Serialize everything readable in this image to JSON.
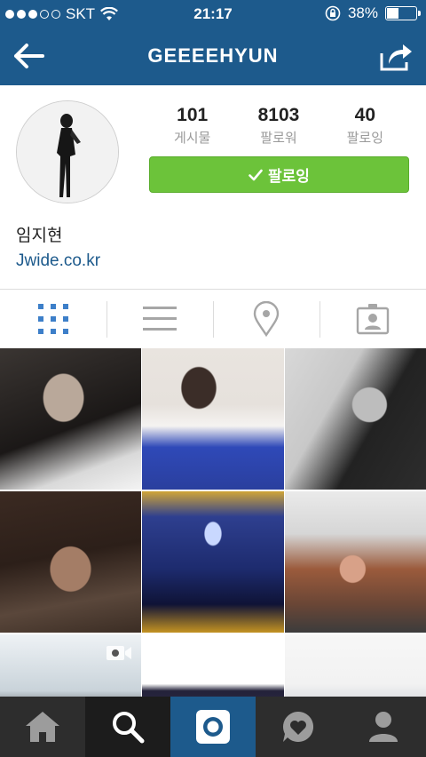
{
  "status_bar": {
    "carrier": "SKT",
    "time": "21:17",
    "battery": "38%",
    "battery_level": 0.38,
    "signal_dots": [
      true,
      true,
      true,
      false,
      false
    ]
  },
  "header": {
    "title": "GEEEEHYUN",
    "icons": {
      "back": "arrow-left-icon",
      "share": "share-icon"
    }
  },
  "profile": {
    "posts_count": "101",
    "posts_label": "게시물",
    "followers_count": "8103",
    "followers_label": "팔로워",
    "following_count": "40",
    "following_label": "팔로잉",
    "follow_button_label": "팔로잉",
    "full_name": "임지현",
    "website": "Jwide.co.kr"
  },
  "tabs": [
    {
      "name": "grid-view",
      "icon": "grid-icon",
      "active": true
    },
    {
      "name": "list-view",
      "icon": "list-icon",
      "active": false
    },
    {
      "name": "map-view",
      "icon": "location-pin-icon",
      "active": false
    },
    {
      "name": "tagged-view",
      "icon": "tagged-user-icon",
      "active": false
    }
  ],
  "grid": {
    "photos": [
      {
        "id": "photo-1",
        "video": false
      },
      {
        "id": "photo-2",
        "video": false
      },
      {
        "id": "photo-3",
        "video": false
      },
      {
        "id": "photo-4",
        "video": false
      },
      {
        "id": "photo-5",
        "video": false
      },
      {
        "id": "photo-6",
        "video": false
      },
      {
        "id": "photo-7",
        "video": true
      },
      {
        "id": "photo-8",
        "video": false
      },
      {
        "id": "photo-9",
        "video": false
      }
    ]
  },
  "bottom_nav": [
    {
      "name": "home",
      "icon": "home-icon"
    },
    {
      "name": "explore",
      "icon": "search-icon"
    },
    {
      "name": "camera",
      "icon": "camera-icon"
    },
    {
      "name": "activity",
      "icon": "heart-bubble-icon"
    },
    {
      "name": "profile",
      "icon": "user-icon"
    }
  ],
  "colors": {
    "header_bg": "#1d5a8c",
    "follow_button": "#6cc33a",
    "link": "#1d5a8c",
    "active_tab": "#3d7fc9",
    "inactive_tab": "#a6a6a6",
    "nav_bg": "#2d2d2d"
  }
}
